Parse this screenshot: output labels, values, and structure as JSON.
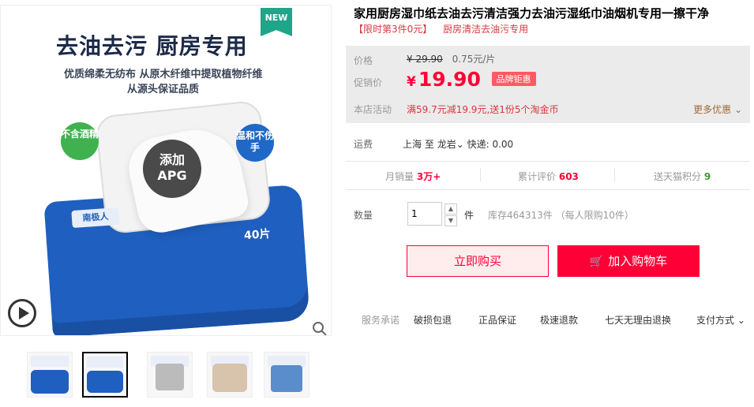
{
  "gallery": {
    "new_badge": "NEW",
    "headline": "去油去污 厨房专用",
    "sub_line1": "优质绵柔无纺布 从原木纤维中提取植物纤维",
    "sub_line2": "从源头保证品质",
    "badge_left": "不含酒精",
    "badge_right": "温和不伤手",
    "apg_line1": "添加",
    "apg_line2": "APG",
    "brand_label": "南极人",
    "count_label": "40片",
    "play_icon": "play-icon",
    "zoom_icon": "zoom-icon",
    "thumbnails": [
      {
        "label": "thumb-1"
      },
      {
        "label": "thumb-2"
      },
      {
        "label": "thumb-3"
      },
      {
        "label": "thumb-4"
      },
      {
        "label": "thumb-5"
      }
    ]
  },
  "product": {
    "title": "家用厨房湿巾纸去油去污清洁强力去油污湿纸巾油烟机专用一擦干净",
    "promo_1": "【限时第3件0元】",
    "promo_2": "厨房清洁去油污专用"
  },
  "price": {
    "orig_label": "价格",
    "orig_value": "¥ 29.90",
    "unit_price": "0.75元/片",
    "promo_label": "促销价",
    "currency": "¥",
    "current": "19.90",
    "discount_badge": "品牌钜惠",
    "store_label": "本店活动",
    "store_activity": "满59.7元减19.9元,送1份5个淘金币",
    "more_label": "更多优惠"
  },
  "shipping": {
    "label": "运费",
    "from": "上海",
    "to_word": "至",
    "to": "龙岩",
    "express": "快递: 0.00"
  },
  "stats": {
    "monthly_label": "月销量",
    "monthly_value": "3万+",
    "reviews_label": "累计评价",
    "reviews_value": "603",
    "points_label": "送天猫积分",
    "points_value": "9"
  },
  "quantity": {
    "label": "数量",
    "value": "1",
    "unit": "件",
    "stock": "库存464313件 （每人限购10件）"
  },
  "buttons": {
    "buy_now": "立即购买",
    "add_cart": "加入购物车"
  },
  "service": {
    "label": "服务承诺",
    "items": [
      "破损包退",
      "正品保证",
      "极速退款",
      "七天无理由退换"
    ],
    "payment": "支付方式"
  },
  "colors": {
    "accent": "#ff0036",
    "price_bg": "#ebebeb",
    "badge": "#1fa58a"
  }
}
